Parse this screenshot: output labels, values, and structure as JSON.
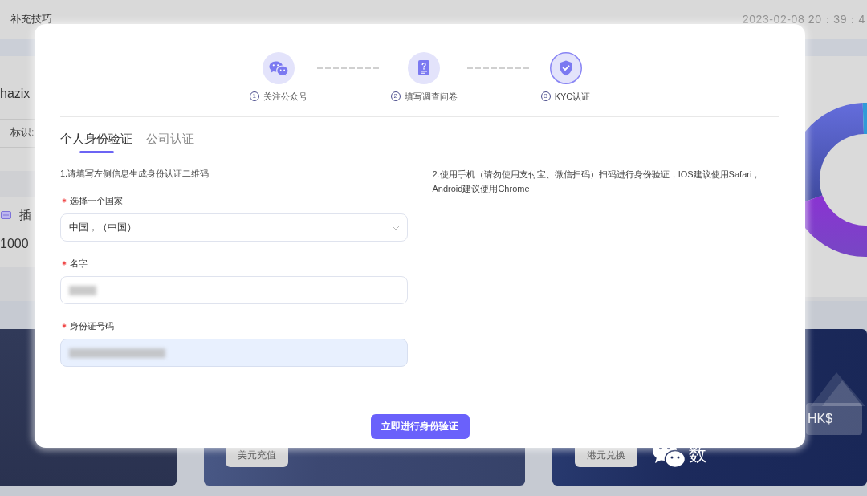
{
  "background_page": {
    "header": {
      "title": "补充技巧",
      "time": "2023-02-08 20：39：4"
    },
    "account_card": {
      "name": "hazix",
      "label": "标识:"
    },
    "slot_card": {
      "title": "插",
      "value": "1000"
    },
    "cards": [
      {
        "kind": "plain"
      },
      {
        "kind": "button",
        "button": "美元充值"
      },
      {
        "kind": "channel",
        "button": "港元兑换",
        "channel": "数",
        "tag": "HK$"
      }
    ]
  },
  "dialog": {
    "steps": [
      {
        "number": "1",
        "label": "关注公众号",
        "selected": false
      },
      {
        "number": "2",
        "label": "填写调查问卷",
        "selected": false
      },
      {
        "number": "3",
        "label": "KYC认证",
        "selected": true
      }
    ],
    "tabs": [
      {
        "label": "个人身份验证",
        "selected": true
      },
      {
        "label": "公司认证",
        "selected": false
      }
    ],
    "left_instruction": "1.请填写左侧信息生成身份认证二维码",
    "fields": [
      {
        "kind": "select",
        "label": "选择一个国家",
        "required": true,
        "value": "中国，（中国）"
      },
      {
        "kind": "input",
        "label": "名字",
        "required": true,
        "redacted": true,
        "autofilled": false
      },
      {
        "kind": "input",
        "label": "身份证号码",
        "required": true,
        "redacted": true,
        "autofilled": true
      }
    ],
    "right_instruction": "2.使用手机（请勿使用支付宝、微信扫码）扫码进行身份验证，IOS建议使用Safari，Android建议使用Chrome",
    "submit_button": "立即进行身份验证"
  }
}
